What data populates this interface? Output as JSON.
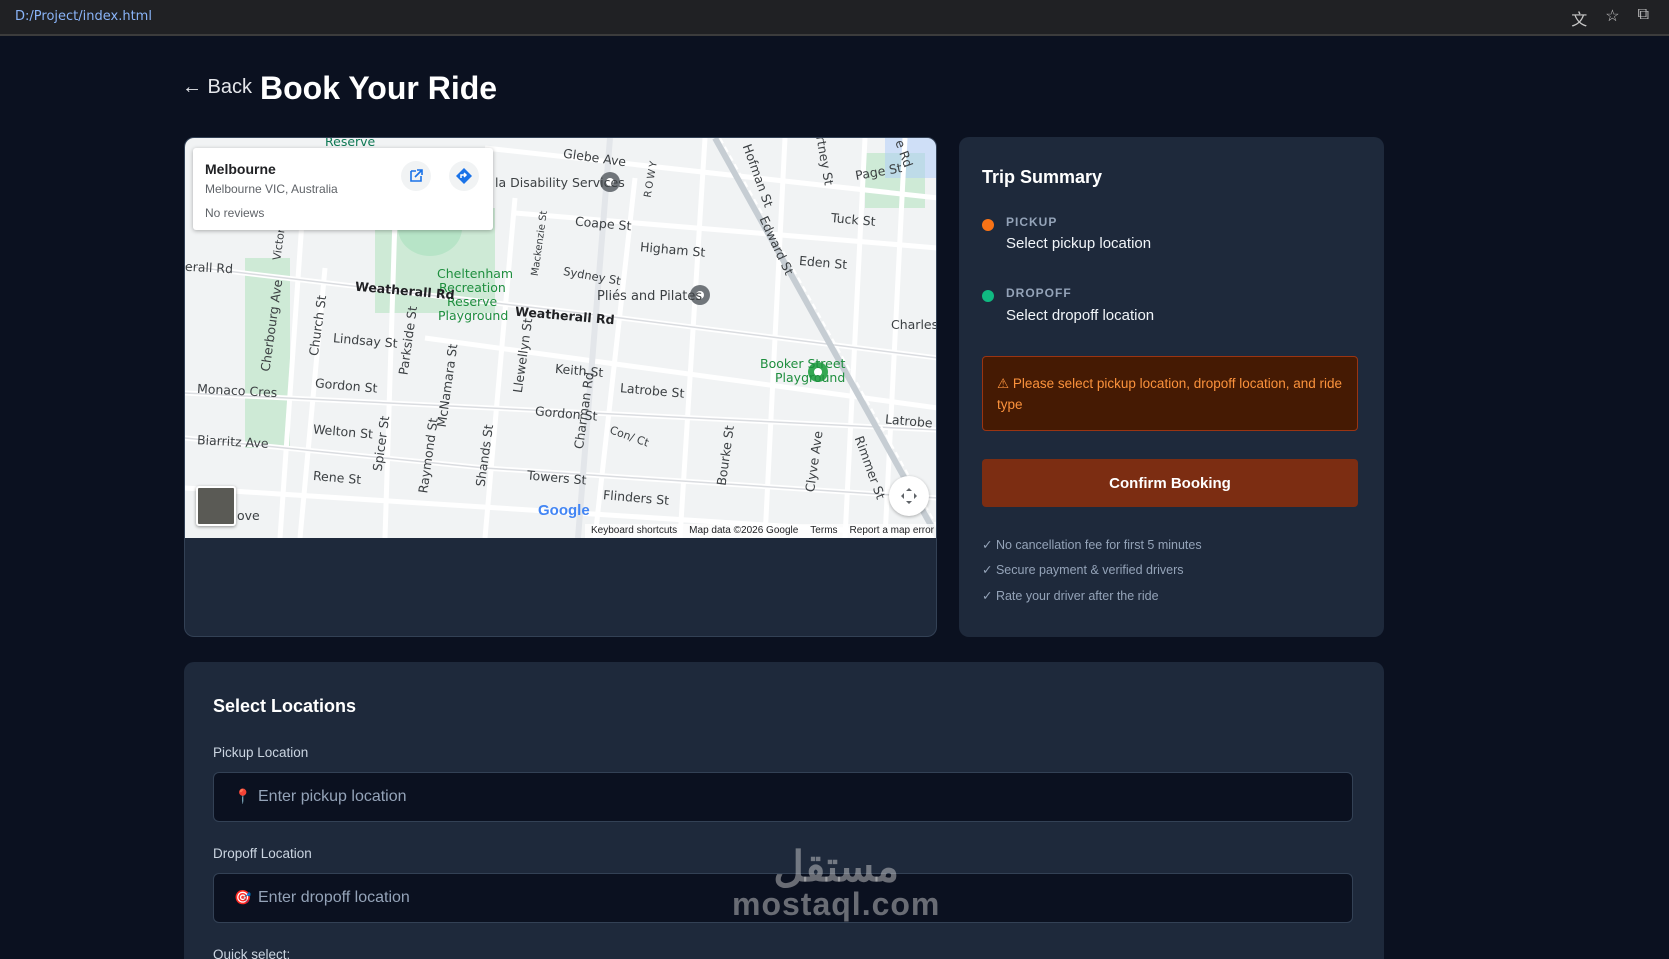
{
  "browser": {
    "url": "D:/Project/index.html",
    "icons": [
      "translate-icon",
      "star-icon",
      "extensions-icon"
    ]
  },
  "header": {
    "back_label": "← Back",
    "title": "Book Your Ride"
  },
  "map": {
    "info_card": {
      "name": "Melbourne",
      "address": "Melbourne VIC, Australia",
      "reviews": "No reviews"
    },
    "labels": {
      "reserve": "Reserve",
      "glebe": "Glebe Ave",
      "disability": "la Disability Services",
      "rowy": "ROWY",
      "hofman": "Hofman St",
      "rtney": "rtney St",
      "page": "Page St",
      "ord": "e Rd",
      "coape": "Coape St",
      "higham": "Higham St",
      "tuck": "Tuck St",
      "edward": "Edward St",
      "eden": "Eden St",
      "erall": "erall Rd",
      "victor": "Victor",
      "mackenzie": "Mackenzie St",
      "sydney": "Sydney St",
      "cheltenham1": "Cheltenham",
      "cheltenham2": "Recreation",
      "cheltenham3": "Reserve",
      "cheltenham4": "Playground",
      "pilates": "Pliés and Pilates",
      "weatherall1": "Weatherall Rd",
      "weatherall2": "Weatherall Rd",
      "charles": "Charles",
      "cherbourg": "Cherbourg Ave",
      "church": "Church St",
      "lindsay": "Lindsay St",
      "parkside": "Parkside St",
      "llewellyn": "Llewellyn St",
      "booker1": "Booker Street",
      "booker2": "Playground",
      "keith": "Keith St",
      "latrobe1": "Latrobe St",
      "monaco": "Monaco Cres",
      "gordon1": "Gordon St",
      "mcnamara": "McNamara St",
      "charman": "Charman Rd",
      "gordon2": "Gordon St",
      "latrobe2": "Latrobe S",
      "welton": "Welton St",
      "spicer": "Spicer St",
      "raymond": "Raymond St",
      "shands": "Shands St",
      "conl": "Con/ Ct",
      "bourke": "Bourke St",
      "clyve": "Clyve Ave",
      "rimmer": "Rimmer St",
      "biarritz": "Biarritz Ave",
      "rene": "Rene St",
      "towers": "Towers St",
      "flinders": "Flinders St",
      "ove": "ove"
    },
    "google": "Google",
    "footer": {
      "shortcuts": "Keyboard shortcuts",
      "data": "Map data ©2026 Google",
      "terms": "Terms",
      "report": "Report a map error"
    }
  },
  "summary": {
    "title": "Trip Summary",
    "pickup_label": "PICKUP",
    "pickup_value": "Select pickup location",
    "pickup_color": "#f97316",
    "dropoff_label": "DROPOFF",
    "dropoff_value": "Select dropoff location",
    "dropoff_color": "#10b981",
    "warning": "⚠ Please select pickup location, dropoff location, and ride type",
    "confirm_label": "Confirm Booking",
    "perks": [
      "✓ No cancellation fee for first 5 minutes",
      "✓ Secure payment & verified drivers",
      "✓ Rate your driver after the ride"
    ]
  },
  "locations": {
    "title": "Select Locations",
    "pickup_label": "Pickup Location",
    "pickup_icon": "📍",
    "pickup_placeholder": "Enter pickup location",
    "dropoff_label": "Dropoff Location",
    "dropoff_icon": "🎯",
    "dropoff_placeholder": "Enter dropoff location",
    "quick_select": "Quick select:"
  },
  "watermark": {
    "arabic": "مستقل",
    "latin": "mostaql.com"
  }
}
